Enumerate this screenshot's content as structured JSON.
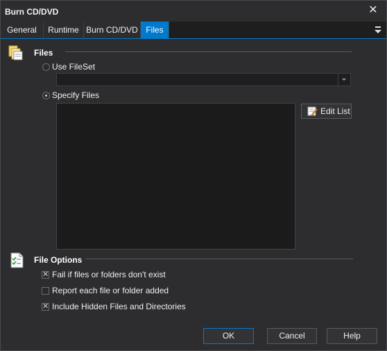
{
  "window": {
    "title": "Burn CD/DVD"
  },
  "tabs": [
    {
      "label": "General"
    },
    {
      "label": "Runtime"
    },
    {
      "label": "Burn CD/DVD"
    },
    {
      "label": "Files",
      "active": true
    }
  ],
  "files_section": {
    "title": "Files",
    "use_fileset_label": "Use FileSet",
    "fileset_value": "",
    "specify_files_label": "Specify Files",
    "selected_option": "Specify Files",
    "edit_list_label": "Edit List"
  },
  "file_options": {
    "title": "File Options",
    "options": [
      {
        "label": "Fail if files or folders don't exist",
        "checked": true
      },
      {
        "label": "Report each file or folder added",
        "checked": false
      },
      {
        "label": "Include Hidden Files and Directories",
        "checked": true
      }
    ]
  },
  "buttons": {
    "ok": "OK",
    "cancel": "Cancel",
    "help": "Help"
  },
  "colors": {
    "accent": "#007acc",
    "background": "#2d2d30",
    "field": "#1e1e1e"
  }
}
